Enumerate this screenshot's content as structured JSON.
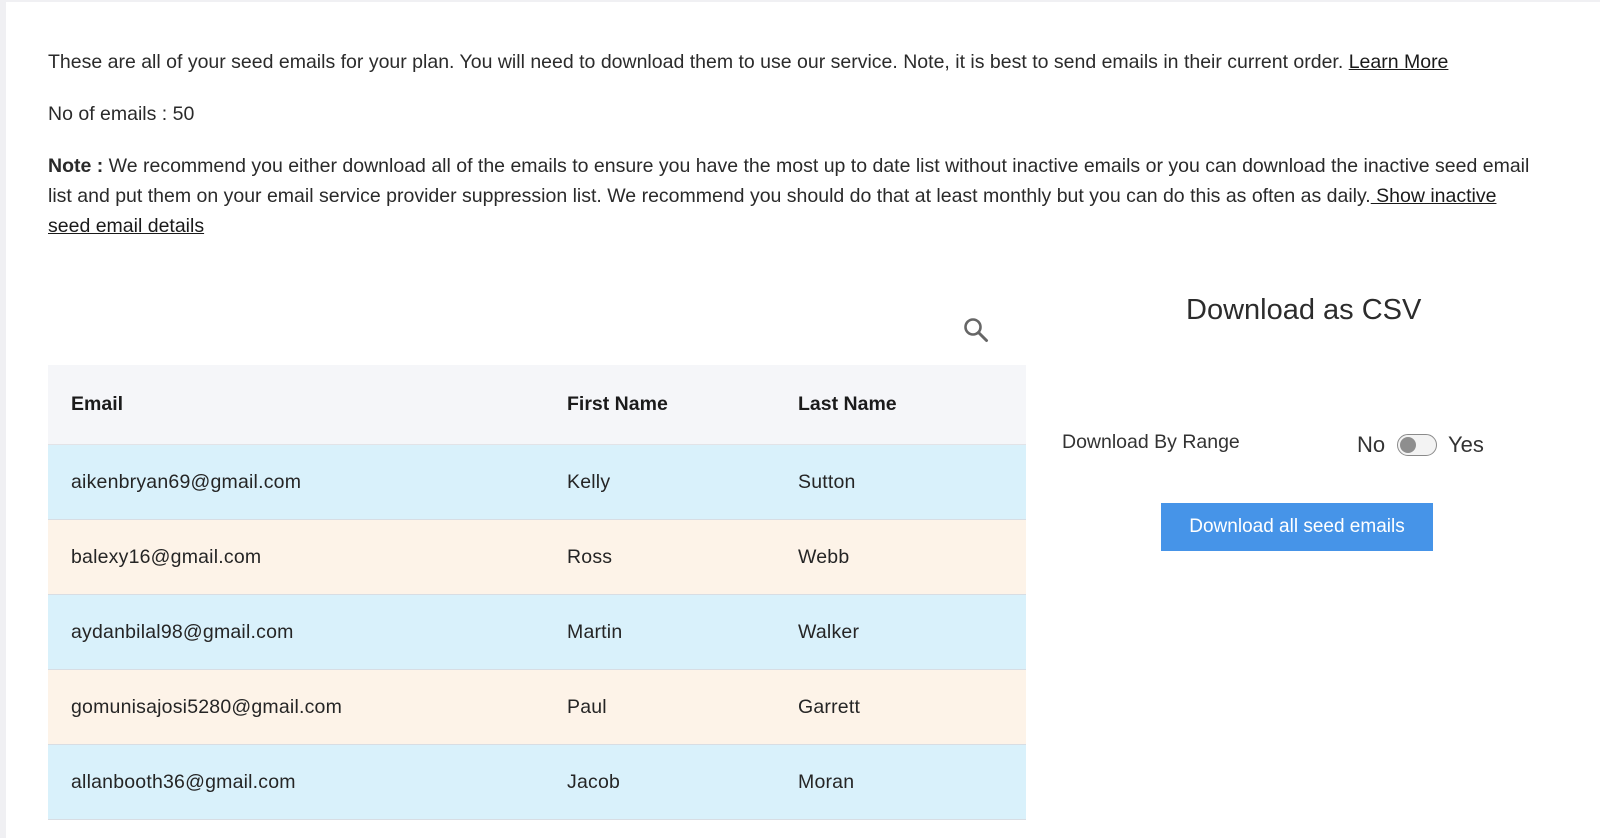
{
  "intro": {
    "text": "These are all of your seed emails for your plan. You will need to download them to use our service. Note, it is best to send emails in their current order. ",
    "link": "Learn More"
  },
  "count": {
    "text": "No of emails : 50"
  },
  "note": {
    "label": "Note :",
    "text": " We recommend you either download all of the emails to ensure you have the most up to date list without inactive emails or you can download the inactive seed email list and put them on your email service provider suppression list. We recommend you should do that at least monthly but you can do this as often as daily.",
    "link": " Show inactive seed email details"
  },
  "search": {
    "icon": "search-icon"
  },
  "table": {
    "headers": [
      "Email",
      "First Name",
      "Last Name"
    ],
    "rows": [
      {
        "email": "aikenbryan69@gmail.com",
        "first": "Kelly",
        "last": "Sutton"
      },
      {
        "email": "balexy16@gmail.com",
        "first": "Ross",
        "last": "Webb"
      },
      {
        "email": "aydanbilal98@gmail.com",
        "first": "Martin",
        "last": "Walker"
      },
      {
        "email": "gomunisajosi5280@gmail.com",
        "first": "Paul",
        "last": "Garrett"
      },
      {
        "email": "allanbooth36@gmail.com",
        "first": "Jacob",
        "last": "Moran"
      }
    ],
    "row_colors": [
      "#d9f1fb",
      "#fdf3e8"
    ]
  },
  "download": {
    "title": "Download as CSV",
    "range_label": "Download By Range",
    "toggle_off": "No",
    "toggle_on": "Yes",
    "toggle_state": false,
    "button_label": "Download all seed emails",
    "button_color": "#4694e8"
  }
}
